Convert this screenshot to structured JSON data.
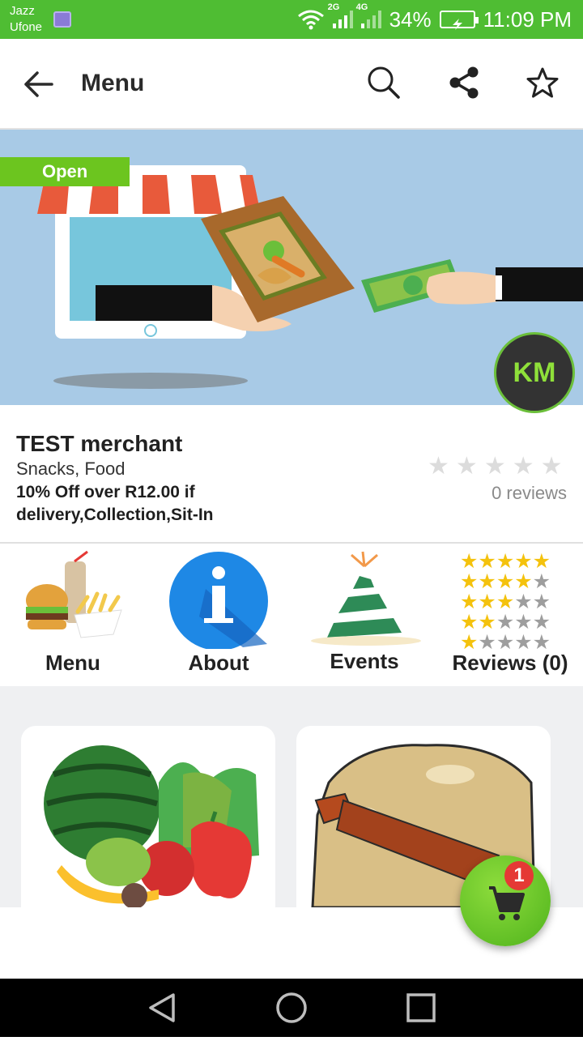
{
  "status_bar": {
    "carrier_1": "Jazz",
    "carrier_2": "Ufone",
    "net_1": "2G",
    "net_2": "4G",
    "battery": "34%",
    "time": "11:09 PM"
  },
  "app_bar": {
    "title": "Menu",
    "icons": [
      "back-arrow-icon",
      "search-icon",
      "share-icon",
      "star-outline-icon"
    ]
  },
  "hero": {
    "status_label": "Open",
    "logo_text": "KM"
  },
  "merchant": {
    "name": "TEST merchant",
    "categories": "Snacks, Food",
    "deal": "10% Off over R12.00 if delivery,Collection,Sit-In",
    "rating_stars": 0,
    "max_stars": 5,
    "reviews_text": "0 reviews"
  },
  "nav": {
    "items": [
      {
        "label": "Menu",
        "icon": "burger-fries-icon"
      },
      {
        "label": "About",
        "icon": "info-icon"
      },
      {
        "label": "Events",
        "icon": "party-hat-icon"
      },
      {
        "label": "Reviews (0)",
        "icon": "rating-stars-icon"
      }
    ]
  },
  "categories": [
    {
      "image": "vegetables-image"
    },
    {
      "image": "dough-rolling-pin-image"
    }
  ],
  "cart": {
    "count": "1"
  },
  "colors": {
    "status_bar": "#4fbd33",
    "accent_green": "#6cc51f",
    "badge_red": "#e53935",
    "info_blue": "#1e88e5"
  }
}
